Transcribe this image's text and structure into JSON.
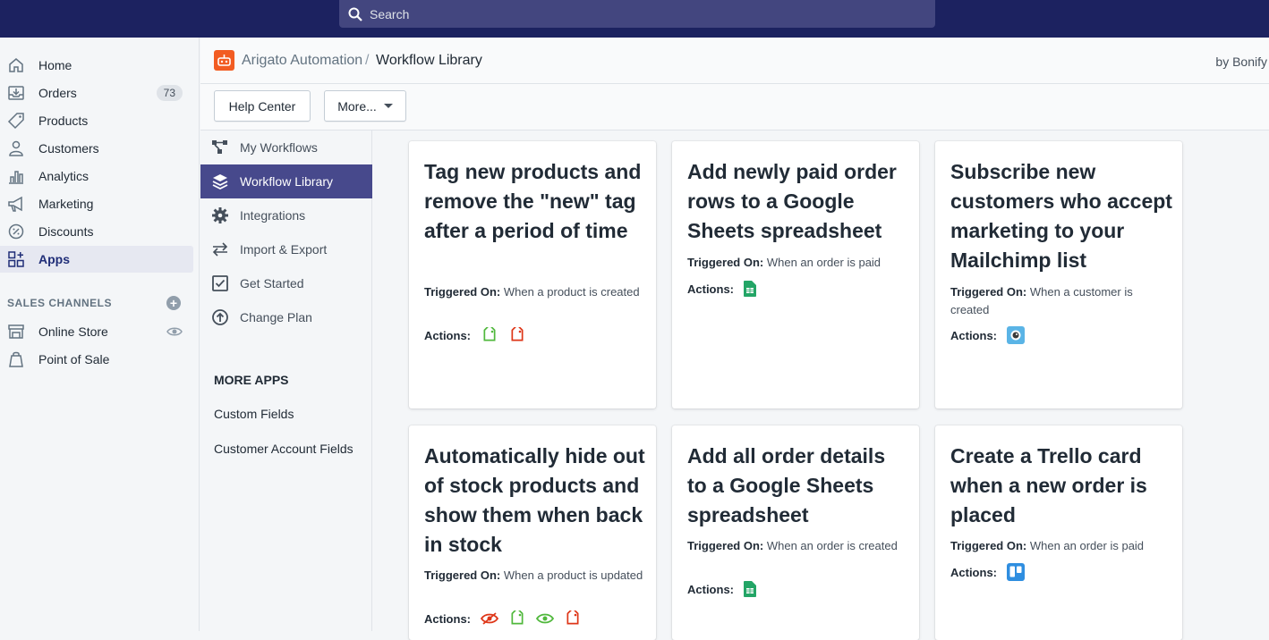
{
  "topbar": {
    "search_placeholder": "Search"
  },
  "nav": {
    "items": [
      {
        "label": "Home",
        "icon": "home-icon"
      },
      {
        "label": "Orders",
        "icon": "orders-icon",
        "badge": "73"
      },
      {
        "label": "Products",
        "icon": "tag-icon"
      },
      {
        "label": "Customers",
        "icon": "person-icon"
      },
      {
        "label": "Analytics",
        "icon": "bar-chart-icon"
      },
      {
        "label": "Marketing",
        "icon": "megaphone-icon"
      },
      {
        "label": "Discounts",
        "icon": "discount-icon"
      },
      {
        "label": "Apps",
        "icon": "apps-icon",
        "active": true
      }
    ],
    "sales_channels_heading": "SALES CHANNELS",
    "channels": [
      {
        "label": "Online Store",
        "icon": "store-icon"
      },
      {
        "label": "Point of Sale",
        "icon": "pos-icon"
      }
    ]
  },
  "appbar": {
    "app_name": "Arigato Automation",
    "separator": "/",
    "current": "Workflow Library",
    "byline": "by Bonify"
  },
  "toolbar": {
    "help_label": "Help Center",
    "more_label": "More..."
  },
  "subnav": {
    "items": [
      {
        "label": "My Workflows",
        "icon": "workflow-icon"
      },
      {
        "label": "Workflow Library",
        "icon": "layers-icon",
        "active": true
      },
      {
        "label": "Integrations",
        "icon": "gear-icon"
      },
      {
        "label": "Import & Export",
        "icon": "swap-arrows-icon"
      },
      {
        "label": "Get Started",
        "icon": "checkbox-icon"
      },
      {
        "label": "Change Plan",
        "icon": "upgrade-circle-icon"
      }
    ],
    "more_apps_heading": "MORE APPS",
    "more_apps": [
      "Custom Fields",
      "Customer Account Fields"
    ]
  },
  "cards": [
    {
      "title": "Tag new products and remove the \"new\" tag after a period of time",
      "trigger_label": "Triggered On:",
      "trigger": "When a product is created",
      "actions_label": "Actions:",
      "actions": [
        "tag-add-icon",
        "tag-remove-icon"
      ]
    },
    {
      "title": "Add newly paid order rows to a Google Sheets spreadsheet",
      "trigger_label": "Triggered On:",
      "trigger": "When an order is paid",
      "actions_label": "Actions:",
      "actions": [
        "google-sheets-icon"
      ]
    },
    {
      "title": "Subscribe new customers who accept marketing to your Mailchimp list",
      "trigger_label": "Triggered On:",
      "trigger": "When a customer is created",
      "actions_label": "Actions:",
      "actions": [
        "mailchimp-icon"
      ]
    },
    {
      "title": "Automatically hide out of stock products and show them when back in stock",
      "trigger_label": "Triggered On:",
      "trigger": "When a product is updated",
      "actions_label": "Actions:",
      "actions": [
        "hide-eye-icon",
        "tag-add-icon",
        "show-eye-icon",
        "tag-remove-icon"
      ]
    },
    {
      "title": "Add all order details to a Google Sheets spreadsheet",
      "trigger_label": "Triggered On:",
      "trigger": "When an order is created",
      "actions_label": "Actions:",
      "actions": [
        "google-sheets-icon"
      ]
    },
    {
      "title": "Create a Trello card when a new order is placed",
      "trigger_label": "Triggered On:",
      "trigger": "When an order is paid",
      "actions_label": "Actions:",
      "actions": [
        "trello-icon"
      ]
    }
  ],
  "colors": {
    "topbar": "#1c2260",
    "active_subnav": "#47498c",
    "brand_logo": "#f25c22"
  }
}
